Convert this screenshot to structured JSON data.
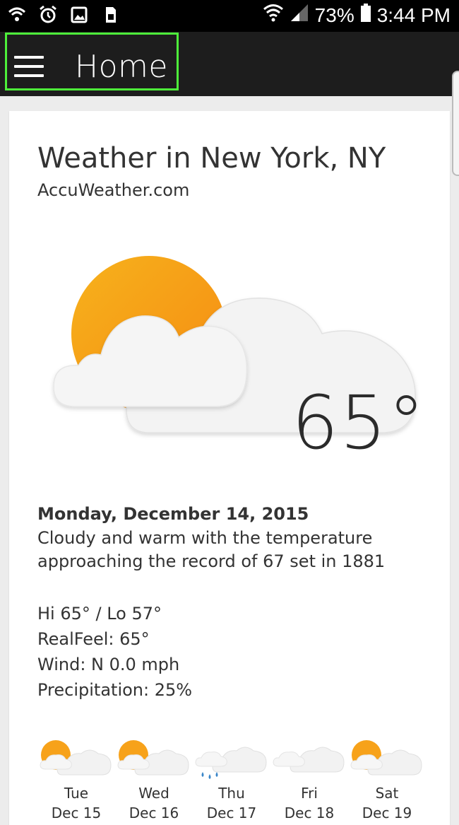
{
  "status_bar": {
    "battery": "73%",
    "time": "3:44 PM",
    "icons": [
      "wifi-call-icon",
      "alarm-icon",
      "image-icon",
      "sim-icon",
      "wifi-icon",
      "signal-icon",
      "battery-icon"
    ]
  },
  "app_bar": {
    "title": "Home",
    "menu_icon": "hamburger-menu-icon",
    "highlight_color": "#4df03a"
  },
  "weather": {
    "title": "Weather in New York, NY",
    "source": "AccuWeather.com",
    "condition_icon": "partly-cloudy-icon",
    "temperature": "65°",
    "date": "Monday, December 14, 2015",
    "description": "Cloudy and warm with the temperature approaching the record of 67 set in 1881",
    "hi_lo": "Hi 65° / Lo 57°",
    "realfeel": "RealFeel: 65°",
    "wind": "Wind: N 0.0 mph",
    "precipitation": "Precipitation: 25%",
    "forecast": [
      {
        "day": "Tue",
        "date": "Dec 15",
        "icon": "partly-sunny-icon"
      },
      {
        "day": "Wed",
        "date": "Dec 16",
        "icon": "partly-sunny-icon"
      },
      {
        "day": "Thu",
        "date": "Dec 17",
        "icon": "rain-icon"
      },
      {
        "day": "Fri",
        "date": "Dec 18",
        "icon": "cloudy-icon"
      },
      {
        "day": "Sat",
        "date": "Dec 19",
        "icon": "partly-sunny-icon"
      }
    ]
  },
  "colors": {
    "sun": "#f7a21a",
    "cloud": "#f2f2f2",
    "rain": "#3a86c8"
  }
}
